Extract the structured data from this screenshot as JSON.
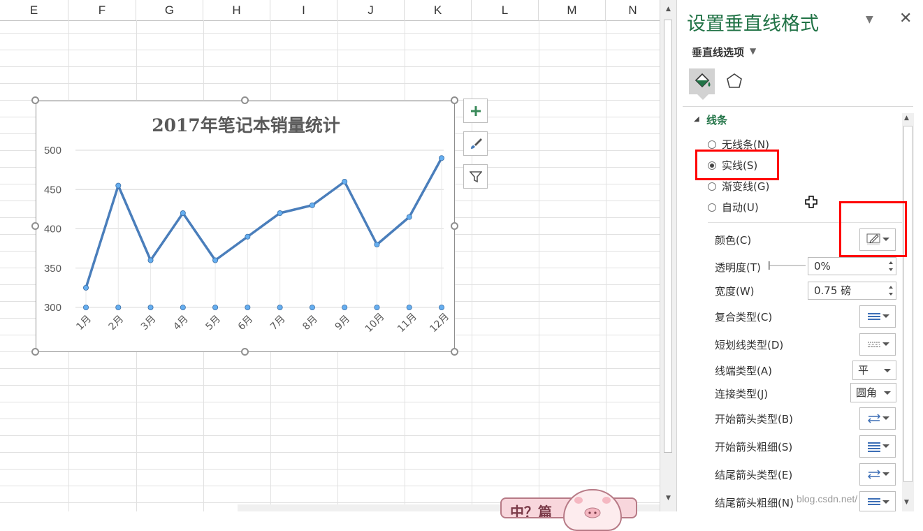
{
  "sheet": {
    "columns": [
      "E",
      "F",
      "G",
      "H",
      "I",
      "J",
      "K",
      "L",
      "M",
      "N"
    ]
  },
  "chart_data": {
    "type": "line",
    "title": "2017年笔记本销量统计",
    "categories": [
      "1月",
      "2月",
      "3月",
      "4月",
      "5月",
      "6月",
      "7月",
      "8月",
      "9月",
      "10月",
      "11月",
      "12月"
    ],
    "series": [
      {
        "values": [
          325,
          455,
          360,
          420,
          360,
          390,
          420,
          430,
          460,
          380,
          415,
          490
        ]
      },
      {
        "values": [
          300,
          300,
          300,
          300,
          300,
          300,
          300,
          300,
          300,
          300,
          300,
          300
        ]
      }
    ],
    "yticks": [
      "300",
      "350",
      "400",
      "450",
      "500"
    ],
    "ylim": [
      300,
      500
    ],
    "grid": true,
    "line_color": "#4a7ebb",
    "marker_color": "#65aef0"
  },
  "chart_buttons": [
    {
      "icon": "plus-icon"
    },
    {
      "icon": "brush-icon"
    },
    {
      "icon": "filter-icon"
    }
  ],
  "panel": {
    "title": "设置垂直线格式",
    "options_label": "垂直线选项",
    "section_title": "线条",
    "radios": [
      {
        "label": "无线条(N)",
        "checked": false
      },
      {
        "label": "实线(S)",
        "checked": true
      },
      {
        "label": "渐变线(G)",
        "checked": false
      },
      {
        "label": "自动(U)",
        "checked": false
      }
    ],
    "props": {
      "color": "颜色(C)",
      "transparency": "透明度(T)",
      "transparency_value": "0%",
      "width": "宽度(W)",
      "width_value": "0.75 磅",
      "compound": "复合类型(C)",
      "dash": "短划线类型(D)",
      "cap": "线端类型(A)",
      "cap_value": "平",
      "join": "连接类型(J)",
      "join_value": "圆角",
      "begin_arrow_type": "开始箭头类型(B)",
      "begin_arrow_size": "开始箭头粗细(S)",
      "end_arrow_type": "结尾箭头类型(E)",
      "end_arrow_size": "结尾箭头粗细(N)"
    },
    "accent_color": "#217346"
  },
  "overlay": {
    "watermark": "blog.csdn.net/",
    "sticker_text": "中？篇"
  }
}
